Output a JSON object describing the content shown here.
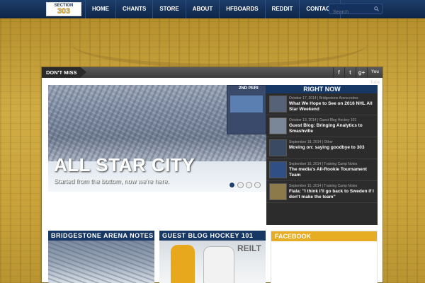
{
  "nav": {
    "logo_top": "SECTION",
    "logo_num": "303",
    "items": [
      "HOME",
      "CHANTS",
      "STORE",
      "ABOUT",
      "HFBOARDS",
      "REDDIT",
      "CONTACT"
    ],
    "search_placeholder": "Search",
    "search_icon": "search-icon"
  },
  "dont_miss": {
    "label": "DON'T MISS",
    "social": {
      "facebook": "f",
      "twitter": "t",
      "googleplus": "g+",
      "youtube": "You Tube"
    }
  },
  "hero": {
    "title": "ALL STAR CITY",
    "subtitle": "Started from the bottom, now we're here.",
    "jumbotron_text": "2ND PERI",
    "slides": 4,
    "active_slide": 1
  },
  "right_now": {
    "heading": "RIGHT NOW",
    "items": [
      {
        "meta": "October 17, 2014 | Bridgestone Arena notes",
        "title": "What We Hope to See on 2016 NHL All Star Weekend",
        "thumb_color": "#556277"
      },
      {
        "meta": "October 13, 2014 | Guest Blog Hockey 101",
        "title": "Guest Blog: Bringing Analytics to Smashville",
        "thumb_color": "#7a8798"
      },
      {
        "meta": "September 18, 2014 | Other",
        "title": "Moving on: saying goodbye to 303",
        "thumb_color": "#3b4a63"
      },
      {
        "meta": "September 16, 2014 | Training Camp Notes",
        "title": "The media's All-Rookie Tournament Team",
        "thumb_color": "#2f4f85"
      },
      {
        "meta": "September 15, 2014 | Training Camp Notes",
        "title": "Fiala: \"I think I'll go back to Sweden if I don't make the team\"",
        "thumb_color": "#8c7a4a"
      }
    ]
  },
  "cards": {
    "bridgestone": "BRIDGESTONE ARENA NOTES",
    "guest_blog": "GUEST BLOG HOCKEY 101",
    "guest_blog_board": "REILT",
    "facebook": "FACEBOOK"
  }
}
